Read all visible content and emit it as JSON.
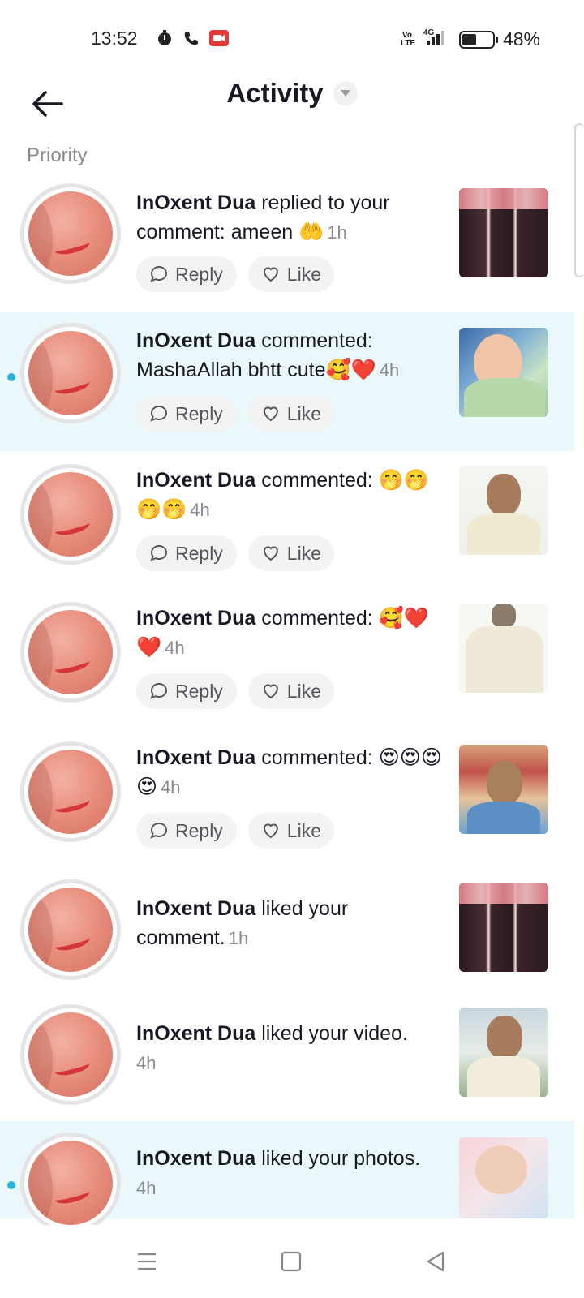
{
  "status_bar": {
    "time": "13:52",
    "battery_percent": "48%",
    "battery_level": 0.48,
    "network": "4G",
    "volte": "Vo LTE"
  },
  "header": {
    "title": "Activity",
    "back_icon": "arrow-left-icon",
    "dropdown_icon": "caret-down-icon"
  },
  "section": {
    "label": "Priority"
  },
  "notifications": [
    {
      "user": "InOxent Dua",
      "action": " replied to your comment: ameen 🤲",
      "time": "1h",
      "unread": false,
      "reply_label": "Reply",
      "like_label": "Like"
    },
    {
      "user": "InOxent Dua",
      "action": " commented: MashaAllah bhtt cute🥰❤️",
      "time": "4h",
      "unread": true,
      "reply_label": "Reply",
      "like_label": "Like"
    },
    {
      "user": "InOxent Dua",
      "action": " commented: 🤭🤭🤭🤭",
      "time": "4h",
      "unread": false,
      "reply_label": "Reply",
      "like_label": "Like"
    },
    {
      "user": "InOxent Dua",
      "action": " commented: 🥰❤️❤️",
      "time": "4h",
      "unread": false,
      "reply_label": "Reply",
      "like_label": "Like"
    },
    {
      "user": "InOxent Dua",
      "action": " commented: 😍😍😍😍",
      "time": "4h",
      "unread": false,
      "reply_label": "Reply",
      "like_label": "Like"
    },
    {
      "user": "InOxent Dua",
      "action": " liked your comment.",
      "time": "1h",
      "unread": false
    },
    {
      "user": "InOxent Dua",
      "action": " liked your video.",
      "time": "4h",
      "unread": false
    },
    {
      "user": "InOxent Dua",
      "action": " liked your photos.",
      "time": "4h",
      "unread": true
    }
  ],
  "colors": {
    "accent_dot": "#25b4d9",
    "highlight_bg": "#eaf8fb",
    "muted_text": "#8a8b91"
  },
  "nav": {
    "menu_icon": "menu-icon",
    "home_icon": "square-icon",
    "back_icon": "triangle-back-icon"
  }
}
